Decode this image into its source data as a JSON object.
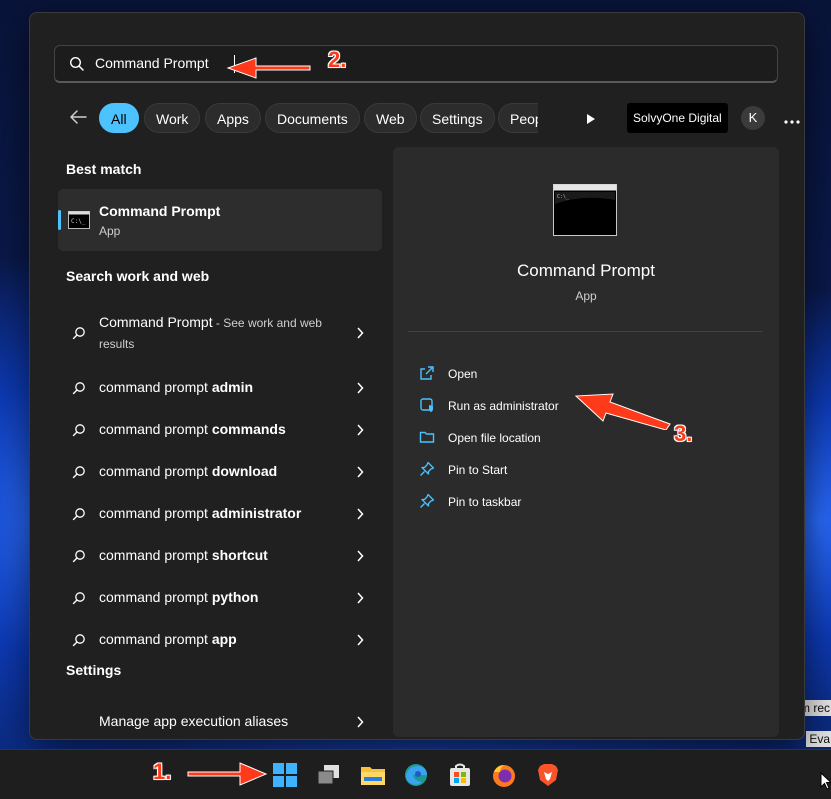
{
  "search": {
    "value": "Command Prompt",
    "placeholder": ""
  },
  "filters": {
    "chips": [
      "All",
      "Work",
      "Apps",
      "Documents",
      "Web",
      "Settings",
      "Peop"
    ],
    "active": "All",
    "org_name": "SolvyOne Digital",
    "avatar_letter": "K"
  },
  "left": {
    "best_match_title": "Best match",
    "best_match": {
      "name": "Command Prompt",
      "type": "App"
    },
    "web_title": "Search work and web",
    "web_first": {
      "prefix": "Command Prompt",
      "hint": " - See work and web results"
    },
    "web_items": [
      {
        "prefix": "command prompt ",
        "bold": "admin"
      },
      {
        "prefix": "command prompt ",
        "bold": "commands"
      },
      {
        "prefix": "command prompt ",
        "bold": "download"
      },
      {
        "prefix": "command prompt ",
        "bold": "administrator"
      },
      {
        "prefix": "command prompt ",
        "bold": "shortcut"
      },
      {
        "prefix": "command prompt ",
        "bold": "python"
      },
      {
        "prefix": "command prompt ",
        "bold": "app"
      }
    ],
    "settings_title": "Settings",
    "settings_item": "Manage app execution aliases"
  },
  "detail": {
    "title": "Command Prompt",
    "subtitle": "App",
    "actions": [
      {
        "label": "Open",
        "icon": "open-external-icon"
      },
      {
        "label": "Run as administrator",
        "icon": "shield-admin-icon"
      },
      {
        "label": "Open file location",
        "icon": "folder-icon"
      },
      {
        "label": "Pin to Start",
        "icon": "pin-icon"
      },
      {
        "label": "Pin to taskbar",
        "icon": "pin-icon"
      }
    ]
  },
  "annotations": {
    "step1": "1.",
    "step2": "2.",
    "step3": "3."
  },
  "taskbar": {
    "icons": [
      "start-icon",
      "task-view-icon",
      "file-explorer-icon",
      "edge-icon",
      "store-icon",
      "firefox-icon",
      "brave-icon"
    ]
  },
  "wallpaper_text": {
    "line1": "em rec",
    "line2": "Eva"
  },
  "colors": {
    "accent": "#4cc2ff",
    "annotation": "#ff3a1a",
    "panel": "#202020",
    "detail": "#2b2b2b"
  }
}
